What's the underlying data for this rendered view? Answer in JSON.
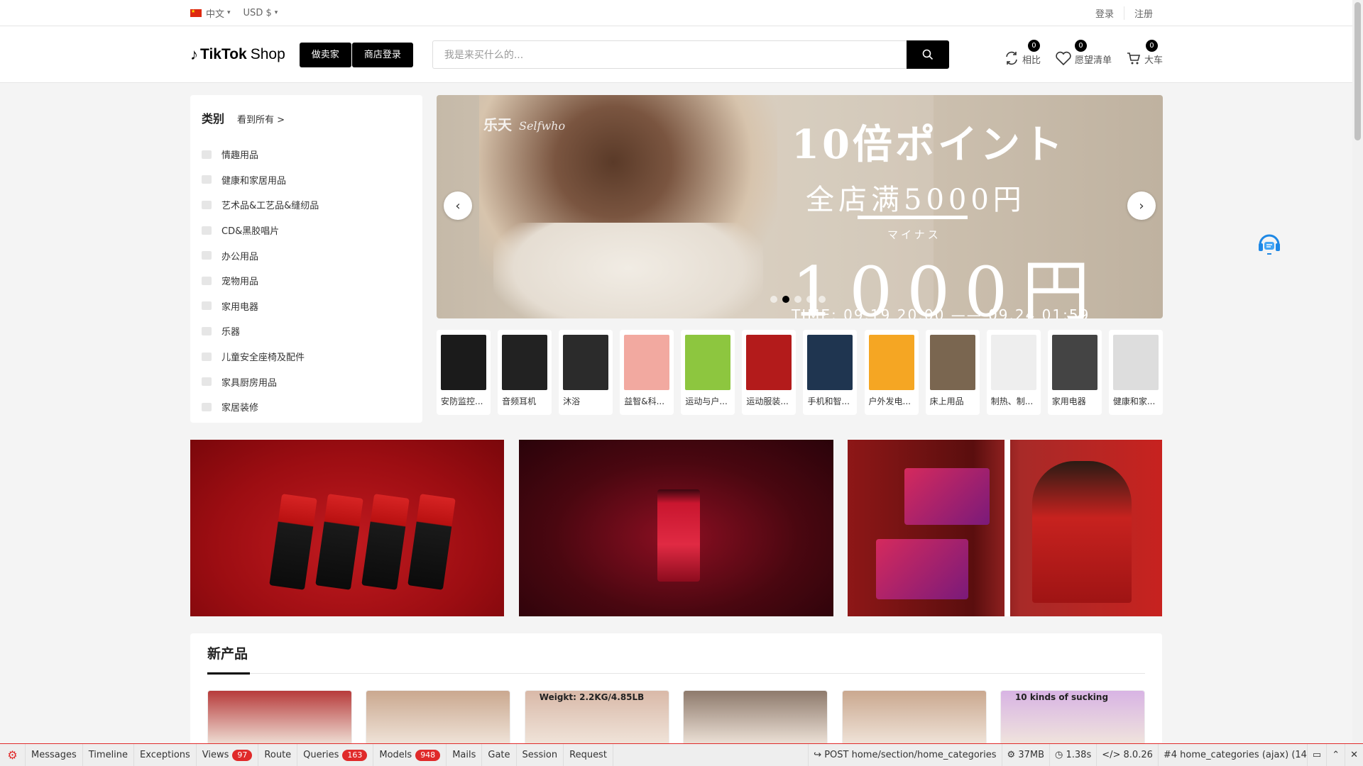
{
  "topbar": {
    "language": "中文",
    "currency": "USD $",
    "login": "登录",
    "register": "注册"
  },
  "header": {
    "logo_text": "TikTok",
    "logo_sub": "Shop",
    "btn_seller": "做卖家",
    "btn_store_login": "商店登录",
    "search_placeholder": "我是来买什么的...",
    "compare": {
      "label": "相比",
      "count": "0"
    },
    "wishlist": {
      "label": "愿望清单",
      "count": "0"
    },
    "cart": {
      "label": "大车",
      "count": "0"
    }
  },
  "categories": {
    "title": "类别",
    "see_all": "看到所有 >",
    "items": [
      "情趣用品",
      "健康和家居用品",
      "艺术品&工艺品&缝纫品",
      "CD&黑胶唱片",
      "办公用品",
      "宠物用品",
      "家用电器",
      "乐器",
      "儿童安全座椅及配件",
      "家具厨房用品",
      "家居装修"
    ]
  },
  "slider": {
    "brand": "乐天",
    "brand_script": "Selfwho",
    "headline": "10倍ポイント",
    "line2": "全店满5000円",
    "line3": "マイナス",
    "big": "1000円",
    "time": "TIME: 09.19 20:00 —— 09.24 01:59",
    "active_dot": 2,
    "dot_count": 5
  },
  "thumbs": [
    {
      "name": "安防监控...",
      "color": "#1b1b1b"
    },
    {
      "name": "音频耳机",
      "color": "#222222"
    },
    {
      "name": "沐浴",
      "color": "#2b2b2b"
    },
    {
      "name": "益智&科...",
      "color": "#f2a9a0"
    },
    {
      "name": "运动与户...",
      "color": "#8dc63f"
    },
    {
      "name": "运动服装...",
      "color": "#b31b1b"
    },
    {
      "name": "手机和智...",
      "color": "#1f3550"
    },
    {
      "name": "户外发电...",
      "color": "#f5a623"
    },
    {
      "name": "床上用品",
      "color": "#7a6650"
    },
    {
      "name": "制热、制...",
      "color": "#eeeeee"
    },
    {
      "name": "家用电器",
      "color": "#444444"
    },
    {
      "name": "健康和家...",
      "color": "#dddddd"
    }
  ],
  "new_products": {
    "title": "新产品",
    "cards": [
      {
        "color": "#b73b3b",
        "text": ""
      },
      {
        "color": "#caa88f",
        "text": ""
      },
      {
        "color": "#d9b9a8",
        "text": "Weigkt:  2.2KG/4.85LB"
      },
      {
        "color": "#8e7a6c",
        "text": ""
      },
      {
        "color": "#caa88f",
        "text": ""
      },
      {
        "color": "#d8b4e4",
        "text": "10 kinds of sucking"
      }
    ]
  },
  "debugbar": {
    "tabs": [
      {
        "label": "Messages",
        "count": ""
      },
      {
        "label": "Timeline",
        "count": ""
      },
      {
        "label": "Exceptions",
        "count": ""
      },
      {
        "label": "Views",
        "count": "97"
      },
      {
        "label": "Route",
        "count": ""
      },
      {
        "label": "Queries",
        "count": "163"
      },
      {
        "label": "Models",
        "count": "948"
      },
      {
        "label": "Mails",
        "count": ""
      },
      {
        "label": "Gate",
        "count": ""
      },
      {
        "label": "Session",
        "count": ""
      },
      {
        "label": "Request",
        "count": ""
      }
    ],
    "route": "POST home/section/home_categories",
    "memory": "37MB",
    "time": "1.38s",
    "version": "8.0.26",
    "request_select": "#4 home_categories (ajax) (14:"
  }
}
